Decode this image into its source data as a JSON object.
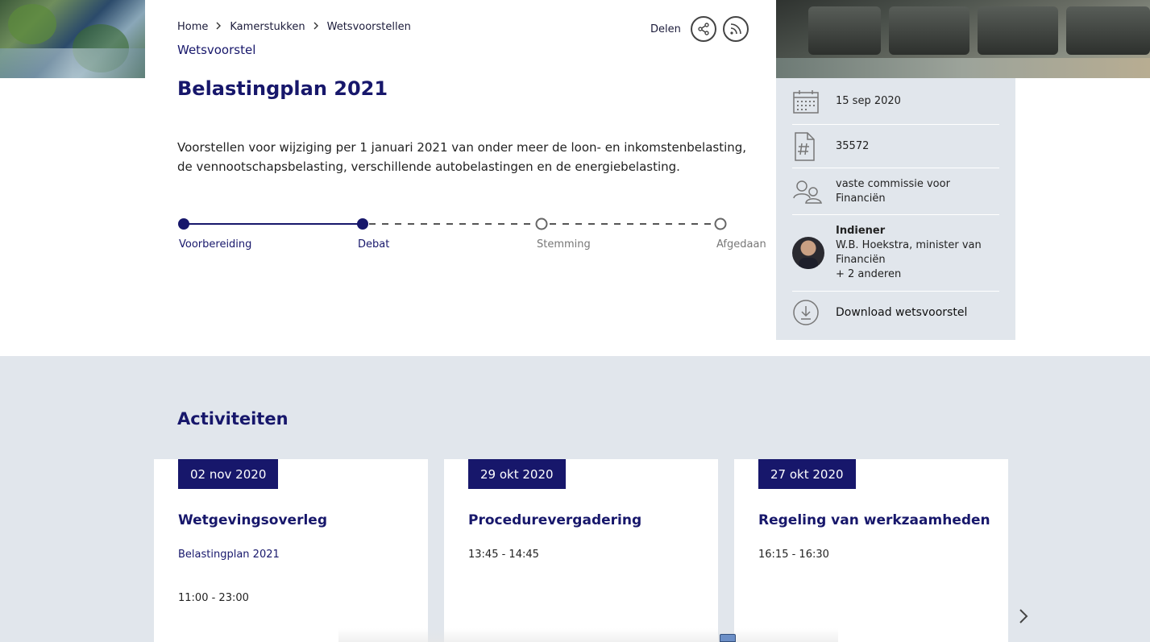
{
  "breadcrumb": {
    "items": [
      "Home",
      "Kamerstukken",
      "Wetsvoorstellen"
    ]
  },
  "share": {
    "label": "Delen"
  },
  "header": {
    "kind": "Wetsvoorstel",
    "title": "Belastingplan 2021",
    "description": "Voorstellen voor wijziging per 1 januari 2021 van onder meer de loon- en inkomstenbelasting, de vennootschapsbelasting, verschillende autobelastingen en de energiebelasting."
  },
  "progress": {
    "steps": [
      {
        "label": "Voorbereiding",
        "done": true
      },
      {
        "label": "Debat",
        "done": true
      },
      {
        "label": "Stemming",
        "done": false
      },
      {
        "label": "Afgedaan",
        "done": false
      }
    ]
  },
  "side": {
    "date": "15 sep 2020",
    "number": "35572",
    "committee": "vaste commissie voor Financiën",
    "submitter_label": "Indiener",
    "submitter_name": "W.B. Hoekstra, minister van Financiën",
    "submitter_more": "+ 2 anderen",
    "download": "Download wetsvoorstel"
  },
  "activities": {
    "title": "Activiteiten",
    "cards": [
      {
        "date": "02 nov 2020",
        "title": "Wetgevingsoverleg",
        "subtitle": "Belastingplan 2021",
        "time": "11:00 - 23:00"
      },
      {
        "date": "29 okt 2020",
        "title": "Procedurevergadering",
        "subtitle": "",
        "time": "13:45 - 14:45"
      },
      {
        "date": "27 okt 2020",
        "title": "Regeling van werkzaamheden",
        "subtitle": "",
        "time": "16:15 - 16:30"
      }
    ]
  },
  "colors": {
    "primary": "#17176b",
    "panel": "#e1e6ec",
    "muted": "#777777"
  },
  "icons": [
    "chevron-right-icon",
    "share-icon",
    "rss-icon",
    "calendar-icon",
    "hash-document-icon",
    "people-icon",
    "download-icon",
    "chevron-next-icon"
  ]
}
